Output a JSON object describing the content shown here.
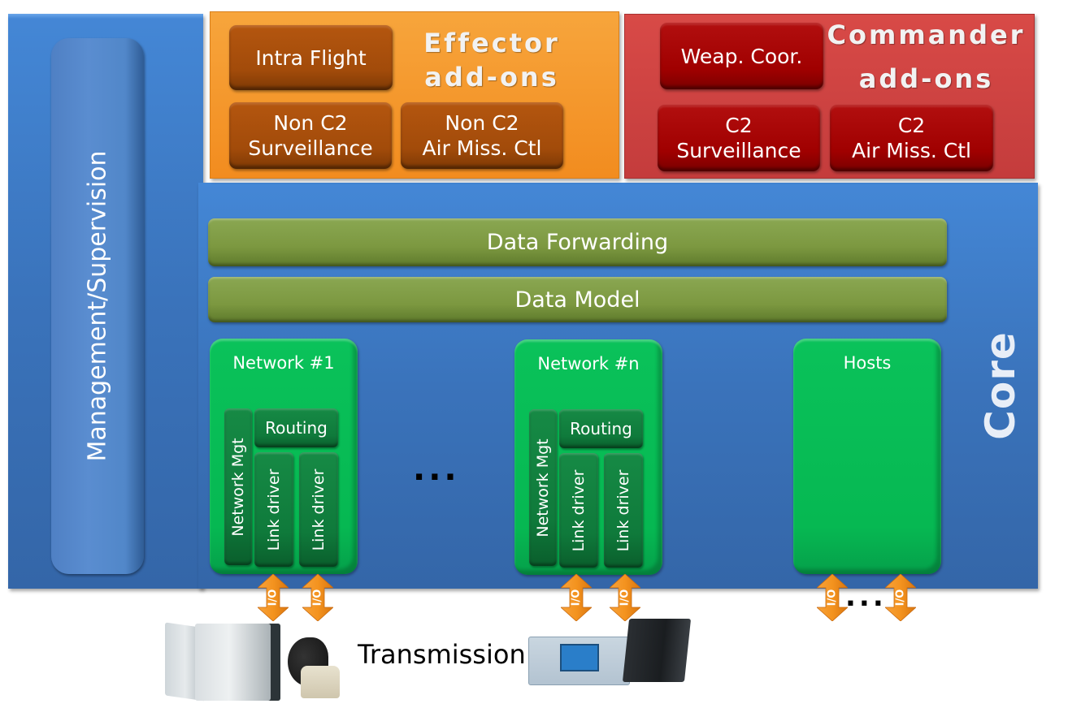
{
  "management": {
    "label": "Management/Supervision"
  },
  "core": {
    "label": "Core"
  },
  "effector": {
    "title_line1": "Effector",
    "title_line2": "add-ons",
    "modules": [
      {
        "line1": "Intra Flight",
        "line2": ""
      },
      {
        "line1": "Non C2",
        "line2": "Surveillance"
      },
      {
        "line1": "Non C2",
        "line2": "Air Miss. Ctl"
      }
    ]
  },
  "commander": {
    "title_line1": "Commander",
    "title_line2": "add-ons",
    "modules": [
      {
        "line1": "Weap. Coor.",
        "line2": ""
      },
      {
        "line1": "C2",
        "line2": "Surveillance"
      },
      {
        "line1": "C2",
        "line2": "Air Miss. Ctl"
      }
    ]
  },
  "layers": {
    "data_forwarding": "Data Forwarding",
    "data_model": "Data Model"
  },
  "networks": [
    {
      "title": "Network #1",
      "mgt": "Network Mgt",
      "routing": "Routing",
      "drivers": [
        "Link driver",
        "Link driver"
      ]
    },
    {
      "title": "Network #n",
      "mgt": "Network Mgt",
      "routing": "Routing",
      "drivers": [
        "Link driver",
        "Link driver"
      ]
    }
  ],
  "hosts": {
    "title": "Hosts"
  },
  "ellipsis": "...",
  "io_label": "I/O",
  "transmission": {
    "label": "Transmission"
  },
  "colors": {
    "core_blue": "#3a73bb",
    "effector_orange": "#f28c1f",
    "commander_red": "#c43c3c",
    "module_green": "#06b852",
    "layer_olive": "#7c9840",
    "io_arrow": "#f0891e"
  }
}
